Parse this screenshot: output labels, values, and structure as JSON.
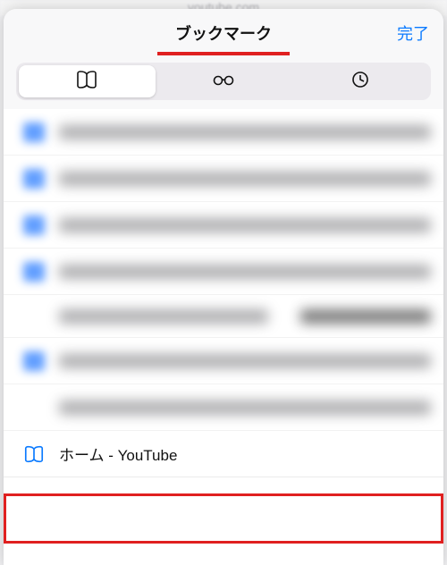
{
  "browser": {
    "url_fragment": "youtube.com"
  },
  "sheet": {
    "title": "ブックマーク",
    "done_label": "完了"
  },
  "tabs": {
    "bookmarks_icon": "book-icon",
    "reading_icon": "glasses-icon",
    "history_icon": "clock-icon",
    "selected_index": 0
  },
  "highlighted_bookmark": {
    "title": "ホーム - YouTube"
  }
}
